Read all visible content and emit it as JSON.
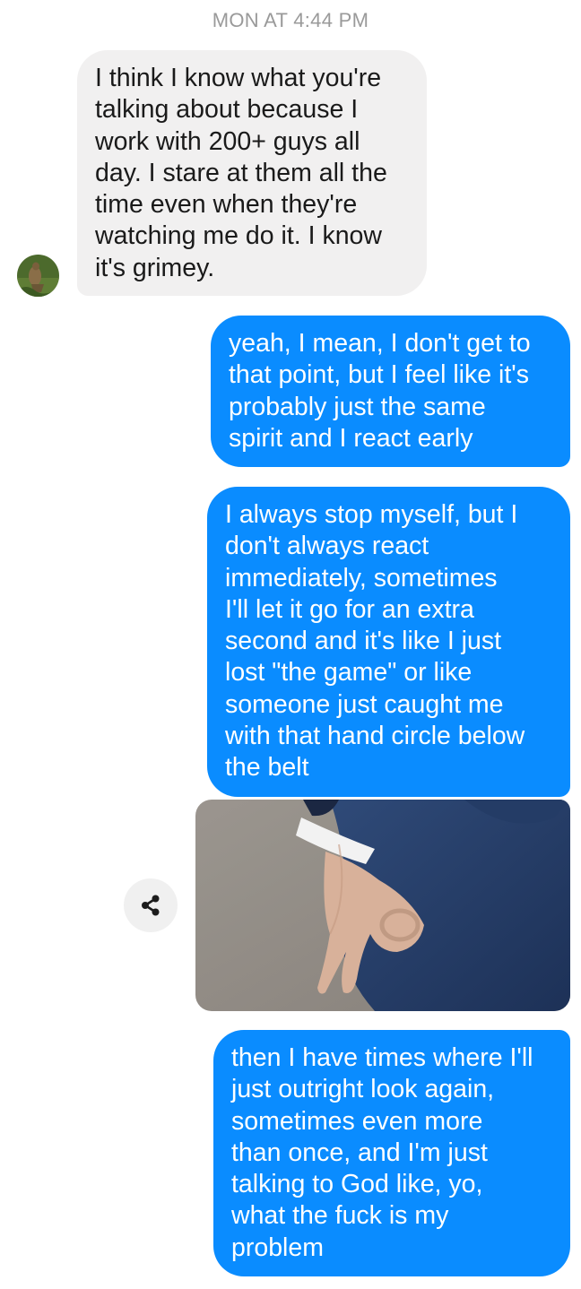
{
  "conversation": {
    "timestamp": "MON AT 4:44 PM",
    "messages": [
      {
        "direction": "received",
        "text": "I think I know what you're\ntalking about because I\nwork with 200+ guys all\nday. I stare at them all the\ntime even when they're\nwatching me do it. I know\nit's grimey."
      },
      {
        "direction": "sent",
        "text": "yeah, I mean, I don't get to\nthat point, but I feel like it's\nprobably just the same\nspirit and I react early"
      },
      {
        "direction": "sent",
        "text": "I always stop myself, but I\ndon't always react\nimmediately, sometimes\nI'll let it go for an extra\nsecond and it's like I just\nlost \"the game\" or like\nsomeone just caught me\nwith that hand circle below\nthe belt"
      },
      {
        "direction": "sent",
        "type": "image"
      },
      {
        "direction": "sent",
        "text": "then I have times where I'll\njust outright look again,\nsometimes even more\nthan once, and I'm just\ntalking to God like, yo,\nwhat the fuck is my\nproblem"
      }
    ]
  },
  "icons": {
    "share": "share-icon",
    "avatar": "contact-avatar"
  },
  "colors": {
    "sent_bubble": "#0a8cff",
    "received_bubble": "#f1f0f0",
    "timestamp": "#9a9a9a"
  }
}
